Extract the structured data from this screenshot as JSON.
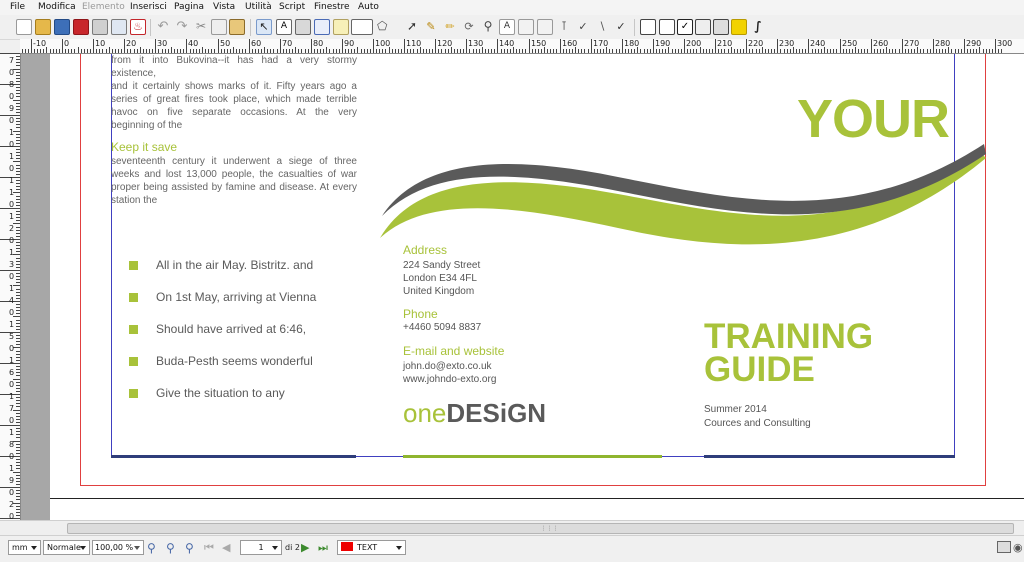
{
  "menu": [
    "File",
    "Modifica",
    "Elemento",
    "Inserisci",
    "Pagina",
    "Vista",
    "Utilità",
    "Script",
    "Finestre",
    "Auto"
  ],
  "ruler": {
    "h_labels": [
      "-10",
      "0",
      "10",
      "20",
      "30",
      "40",
      "50",
      "60",
      "70",
      "80",
      "90",
      "100",
      "110",
      "120",
      "130",
      "140",
      "150",
      "160",
      "170",
      "180",
      "190",
      "200",
      "210",
      "220",
      "230",
      "240",
      "250",
      "260",
      "270",
      "280",
      "290",
      "300"
    ],
    "v_labels": [
      "7",
      "0",
      "8",
      "0",
      "9",
      "0",
      "1",
      "0",
      "1",
      "0",
      "1",
      "1",
      "0",
      "1",
      "2",
      "0",
      "1",
      "3",
      "0",
      "1",
      "4",
      "0",
      "1",
      "5",
      "0",
      "1",
      "6",
      "0",
      "1",
      "7",
      "0",
      "1",
      "8",
      "0",
      "1",
      "9",
      "0",
      "2",
      "0"
    ]
  },
  "doc": {
    "intro_lines": [
      "from it into Bukovina--it has had a very stormy existence,",
      "and it certainly shows marks of it. Fifty years ago a series of great fires took place, which made terrible havoc on five separate occasions. At the very beginning of the"
    ],
    "section_heading": "Keep it save",
    "section_body": "seventeenth century it underwent a siege of three weeks and lost 13,000 people, the casualties of war proper being assisted by famine and disease. At every station the",
    "bullets": [
      "All in the air May. Bistritz. and",
      "On 1st May, arriving at Vienna",
      "Should have arrived at 6:46,",
      "Buda-Pesth seems wonderful",
      "Give the situation to any"
    ],
    "address_label": "Address",
    "address_lines": [
      "224 Sandy Street",
      "London E34 4FL",
      "United Kingdom"
    ],
    "phone_label": "Phone",
    "phone": "+4460 5094 8837",
    "email_label": "E-mail and website",
    "email": "john.do@exto.co.uk",
    "website": "www.johndo-exto.org",
    "logo_light": "one",
    "logo_bold": "DESiGN",
    "big_your": "YOUR",
    "title_line1": "TRAINING",
    "title_line2": "GUIDE",
    "subtitle1": "Summer 2014",
    "subtitle2": "Cources and Consulting"
  },
  "status": {
    "unit": "mm",
    "mode": "Normale",
    "zoom": "100,00 %",
    "page": "1",
    "of_pages": "di 2",
    "layer": "TEXT"
  },
  "colors": {
    "accent_green": "#a8c23a",
    "dark_gray": "#5a5a5a",
    "layer_red": "#ee0000"
  },
  "icons": [
    "new-icon",
    "open-icon",
    "save-icon",
    "close-doc-icon",
    "print-icon",
    "preflight-icon",
    "pdf-icon",
    "undo-icon",
    "redo-icon",
    "cut-icon",
    "copy-icon",
    "paste-icon",
    "select-icon",
    "text-frame-icon",
    "image-frame-icon",
    "render-frame-icon",
    "table-icon",
    "shape-icon",
    "polygon-icon",
    "line-icon",
    "bezier-icon",
    "freehand-icon",
    "rotate-icon",
    "zoom-icon",
    "edit-text-icon",
    "link-text-icon",
    "unlink-text-icon",
    "measure-icon",
    "copy-properties-icon",
    "eyedropper-icon",
    "pdf-button-icon",
    "pdf-textfield-icon",
    "pdf-checkbox-icon",
    "pdf-combobox-icon",
    "pdf-listbox-icon",
    "pdf-annotation-icon",
    "pdf-link-icon"
  ]
}
